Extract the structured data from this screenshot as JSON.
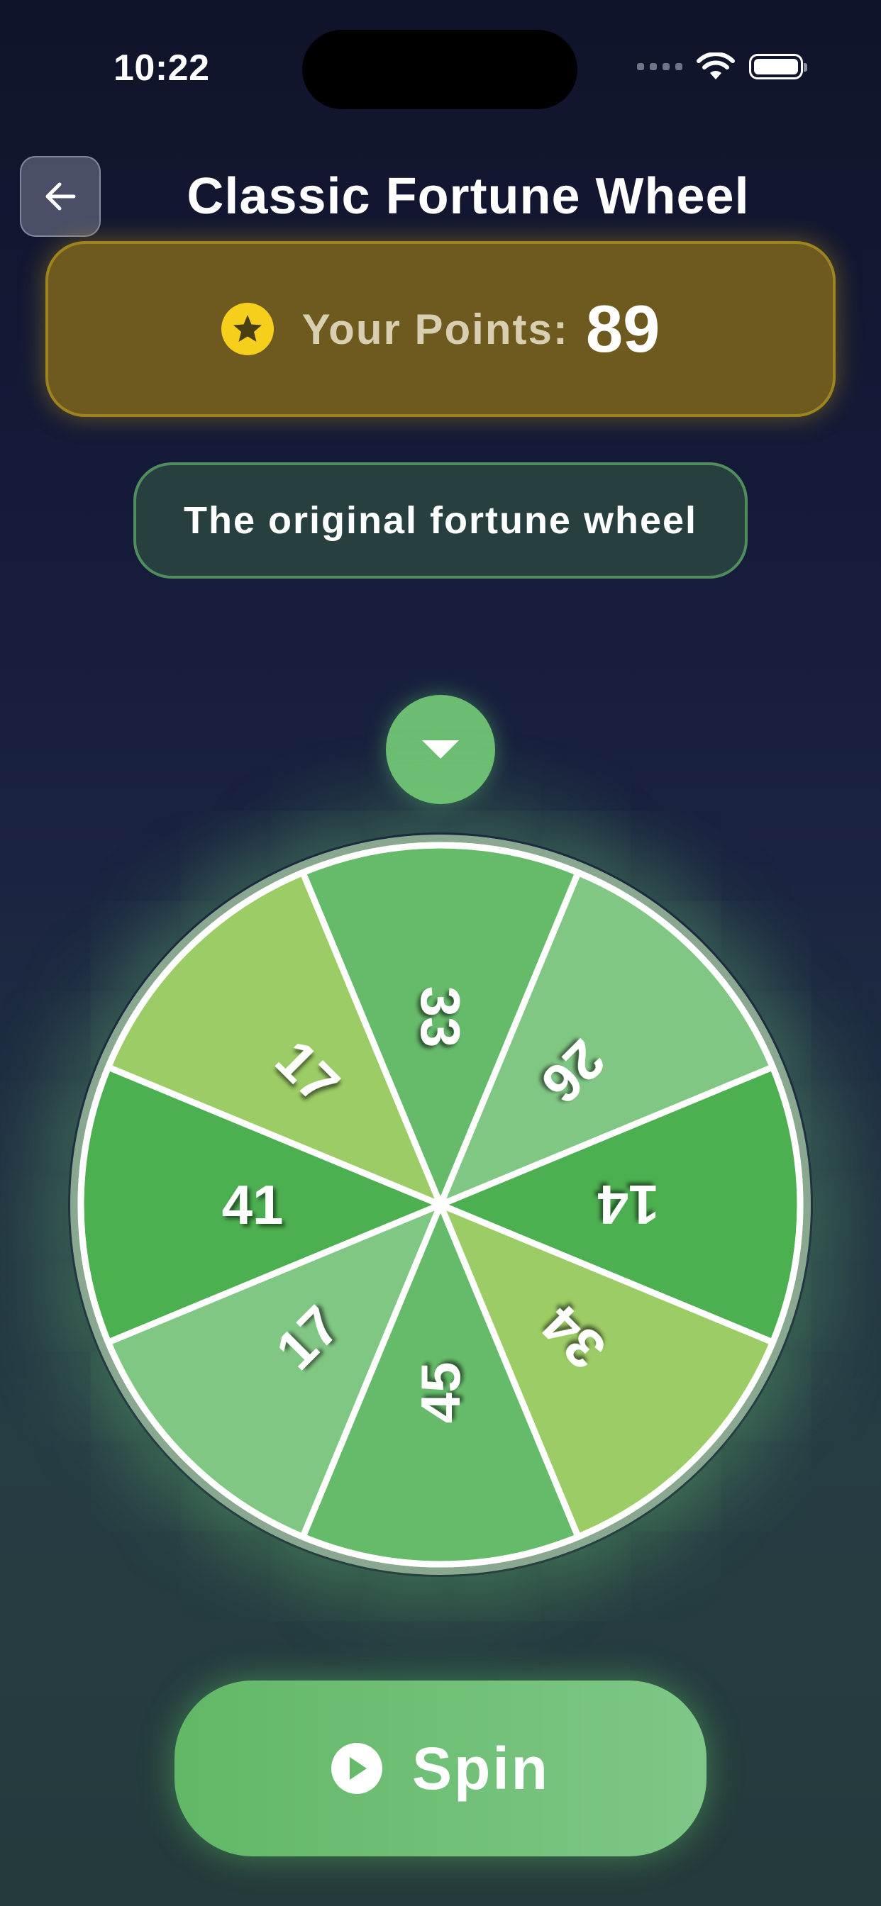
{
  "status_bar": {
    "time": "10:22"
  },
  "header": {
    "title": "Classic Fortune Wheel",
    "back_icon": "arrow-left-icon"
  },
  "points": {
    "label": "Your Points:",
    "value": "89",
    "icon": "star-icon"
  },
  "subtitle": "The original fortune wheel",
  "wheel": {
    "segments": [
      {
        "value": "33",
        "color": "#66bb6a"
      },
      {
        "value": "26",
        "color": "#81c784"
      },
      {
        "value": "14",
        "color": "#4caf50"
      },
      {
        "value": "34",
        "color": "#9ccc65"
      },
      {
        "value": "45",
        "color": "#66bb6a"
      },
      {
        "value": "17",
        "color": "#81c784"
      },
      {
        "value": "41",
        "color": "#4caf50"
      },
      {
        "value": "17",
        "color": "#9ccc65"
      }
    ],
    "pointer_icon": "caret-down-icon"
  },
  "spin_button": {
    "label": "Spin",
    "icon": "play-circle-icon"
  },
  "colors": {
    "accent_green": "#66bb6a",
    "points_gold": "#f6cf1c"
  }
}
